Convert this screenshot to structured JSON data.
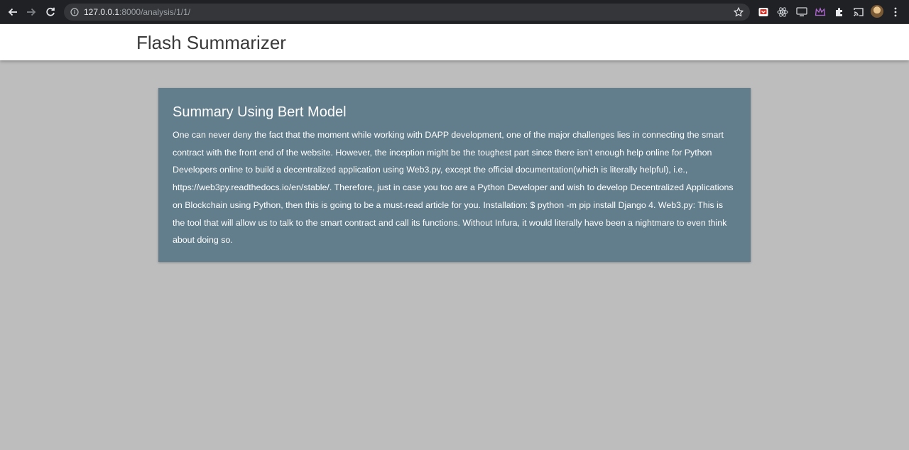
{
  "browser": {
    "url_host": "127.0.0.1",
    "url_rest": ":8000/analysis/1/1/"
  },
  "header": {
    "brand": "Flash Summarizer"
  },
  "summary": {
    "title": "Summary Using Bert Model",
    "body": "One can never deny the fact that the moment while working with DAPP development, one of the major challenges lies in connecting the smart contract with the front end of the website. However, the inception might be the toughest part since there isn't enough help online for Python Developers online to build a decentralized application using Web3.py, except the official documentation(which is literally helpful), i.e., https://web3py.readthedocs.io/en/stable/. Therefore, just in case you too are a Python Developer and wish to develop Decentralized Applications on Blockchain using Python, then this is going to be a must-read article for you. Installation: $ python -m pip install Django 4. Web3.py: This is the tool that will allow us to talk to the smart contract and call its functions. Without Infura, it would literally have been a nightmare to even think about doing so."
  },
  "colors": {
    "page_bg": "#bdbdbd",
    "card_bg": "#627d8b",
    "chrome_bg": "#202124"
  },
  "icons": {
    "back": "back-arrow-icon",
    "forward": "forward-arrow-icon",
    "reload": "reload-icon",
    "info": "info-icon",
    "bookmark": "star-icon",
    "extensions": [
      "pocket-icon",
      "react-icon",
      "monitor-icon",
      "crown-icon",
      "puzzle-icon"
    ],
    "cast": "cast-icon",
    "menu": "kebab-menu-icon"
  }
}
